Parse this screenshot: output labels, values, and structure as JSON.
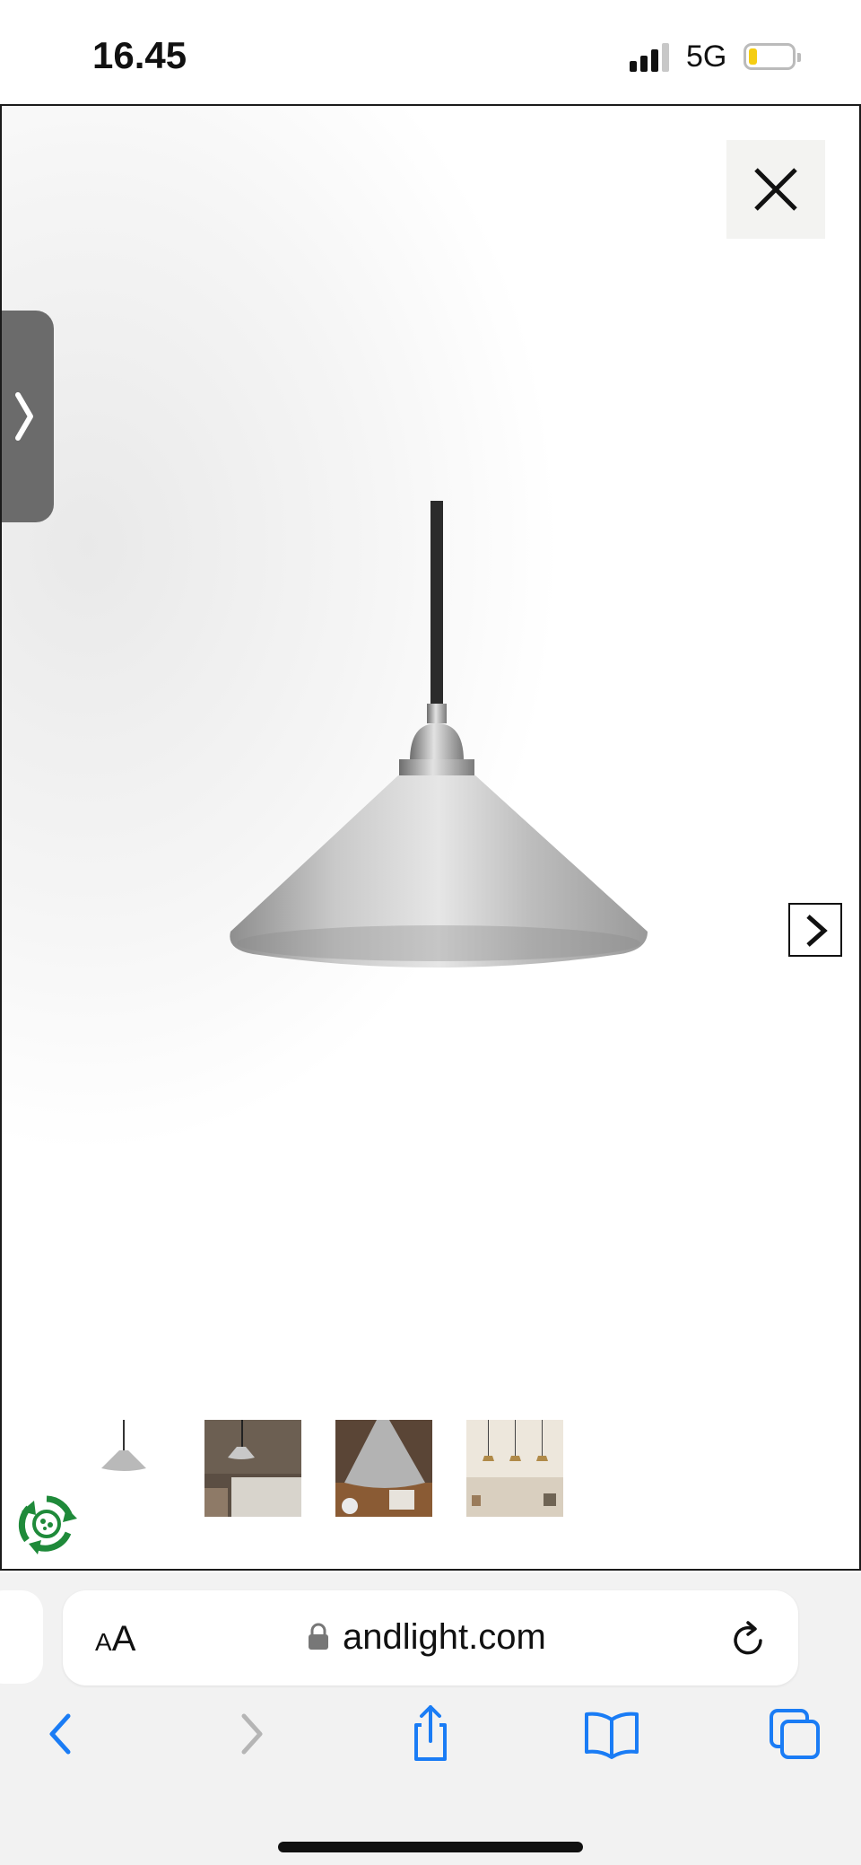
{
  "status_bar": {
    "time": "16.45",
    "network": "5G",
    "signal_bars": 3,
    "battery_level_fraction": 0.15,
    "battery_color": "#f5cd12"
  },
  "lightbox": {
    "close_icon": "close-icon",
    "side_tab_icon": "chevron-right-icon",
    "next_icon": "chevron-right-icon",
    "product_image": "aluminium-cone-pendant-lamp",
    "thumbnails": [
      {
        "name": "thumb-lamp-product",
        "selected": true
      },
      {
        "name": "thumb-lamp-bedroom"
      },
      {
        "name": "thumb-lamp-table-closeup"
      },
      {
        "name": "thumb-lamps-kitchen"
      }
    ],
    "badge_icon": "recycle-icon"
  },
  "browser": {
    "text_size_button": {
      "small": "A",
      "big": "A"
    },
    "url": "andlight.com",
    "lock_icon": "lock-icon",
    "reload_icon": "reload-icon",
    "toolbar": [
      {
        "icon": "back-icon",
        "enabled": true
      },
      {
        "icon": "forward-icon",
        "enabled": false
      },
      {
        "icon": "share-icon",
        "enabled": true
      },
      {
        "icon": "bookmarks-icon",
        "enabled": true
      },
      {
        "icon": "tabs-icon",
        "enabled": true
      }
    ],
    "accent_color": "#1a7cf5"
  }
}
